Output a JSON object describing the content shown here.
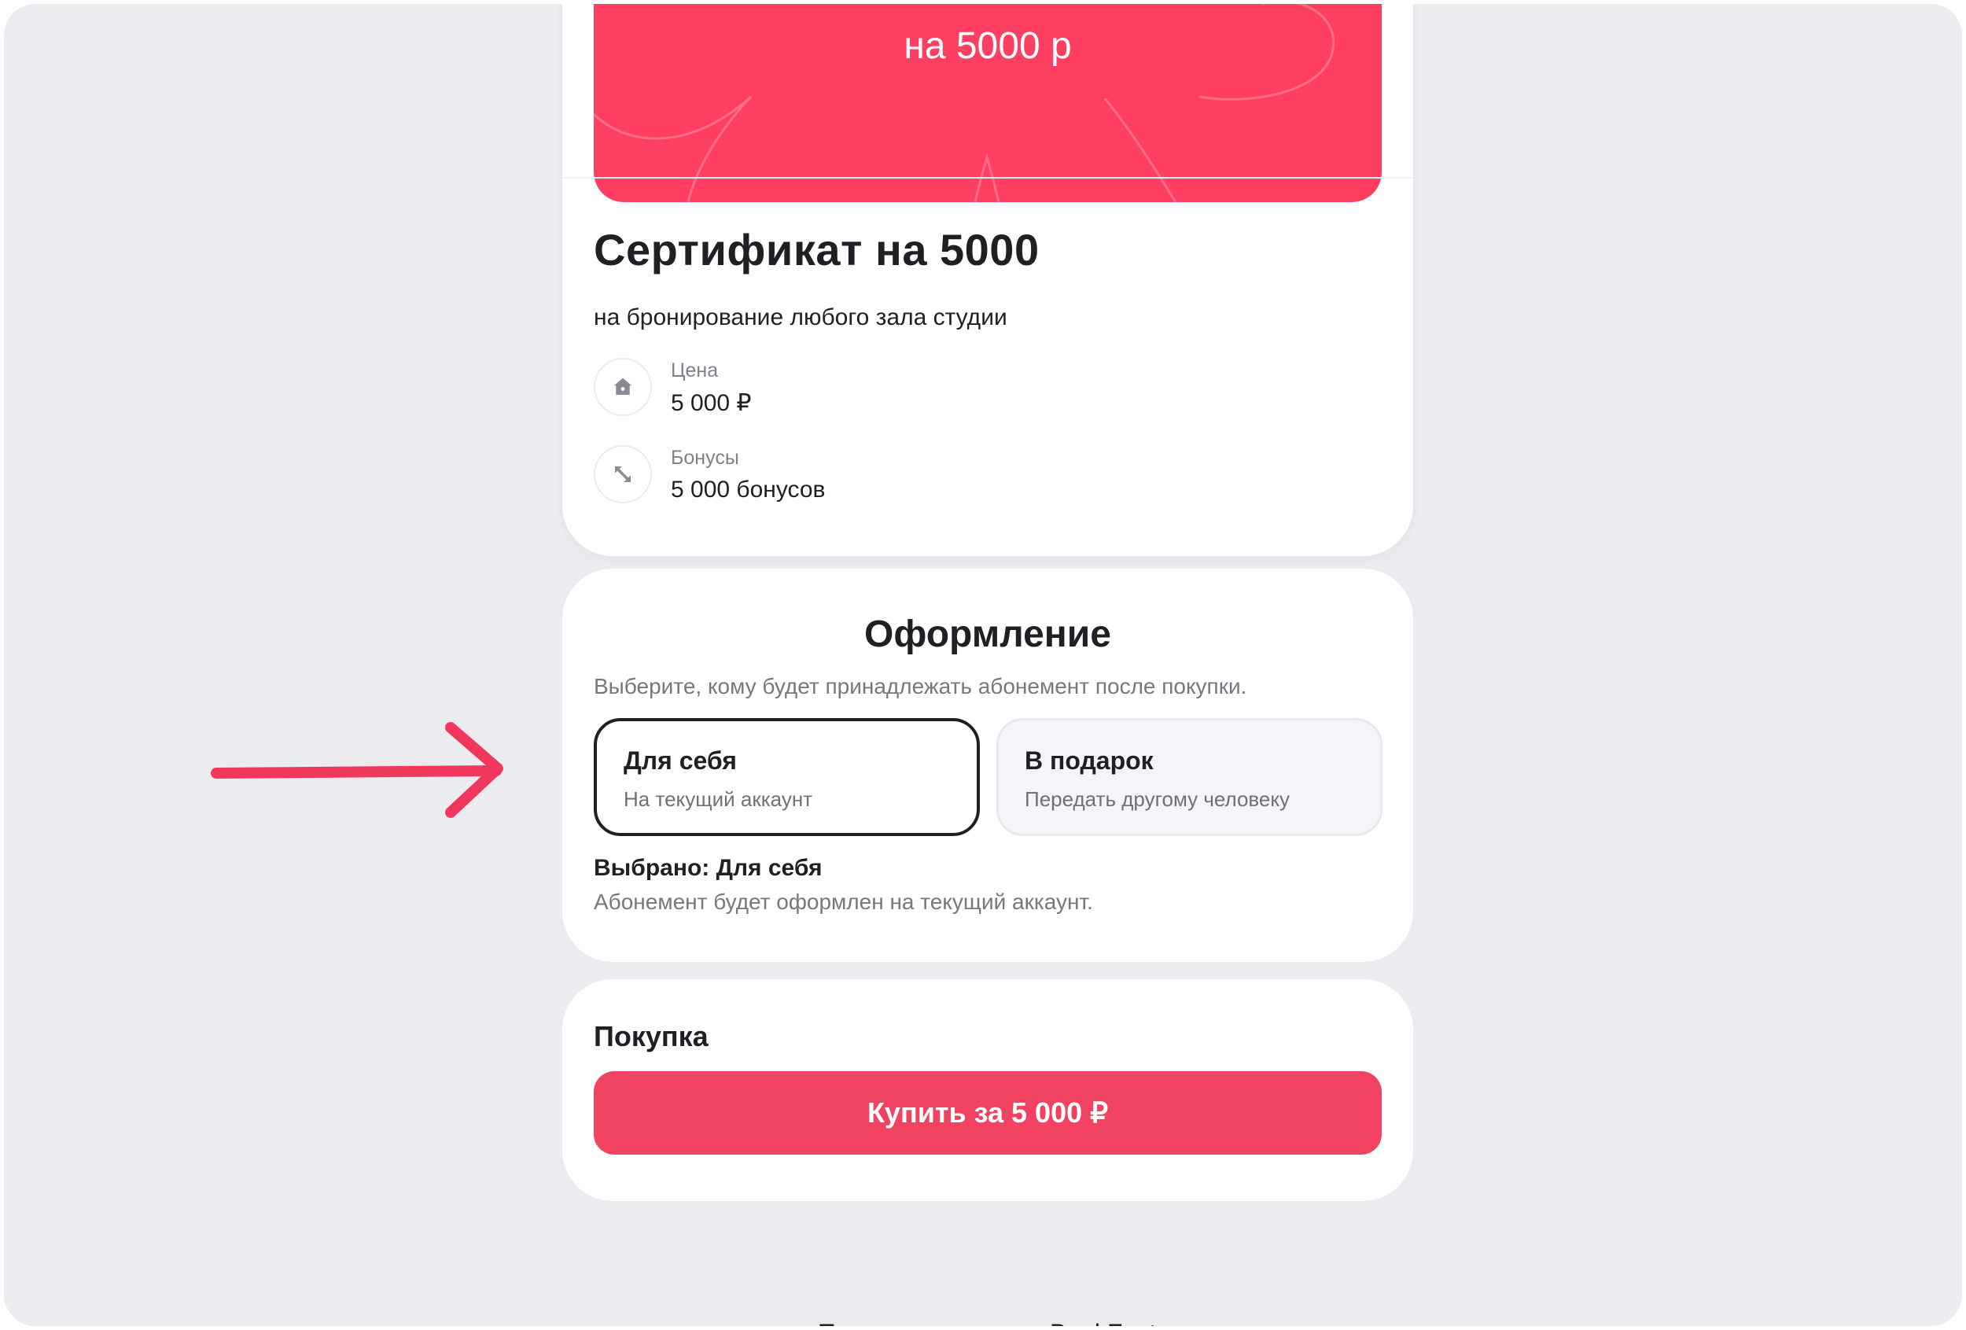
{
  "certificate": {
    "banner_text": "на 5000 р",
    "title": "Сертификат на 5000",
    "subtitle": "на бронирование любого зала студии",
    "price": {
      "label": "Цена",
      "value": "5 000 ₽",
      "icon": "home-icon"
    },
    "bonuses": {
      "label": "Бонусы",
      "value": "5 000 бонусов",
      "icon": "arrows-icon"
    }
  },
  "registration": {
    "title": "Оформление",
    "hint": "Выберите, кому будет принадлежать абонемент после покупки.",
    "options": [
      {
        "title": "Для себя",
        "subtitle": "На текущий аккаунт",
        "selected": true
      },
      {
        "title": "В подарок",
        "subtitle": "Передать другому человеку",
        "selected": false
      }
    ],
    "chosen_title": "Выбрано: Для себя",
    "chosen_desc": "Абонемент будет оформлен на текущий аккаунт."
  },
  "purchase": {
    "title": "Покупка",
    "button_label": "Купить за 5 000 ₽"
  },
  "footer": {
    "link_text": "Правила и условия BookFest"
  },
  "colors": {
    "accent": "#ff3f62",
    "button": "#f14262",
    "annotation_arrow": "#f0385c",
    "page_bg": "#ebebf0"
  }
}
